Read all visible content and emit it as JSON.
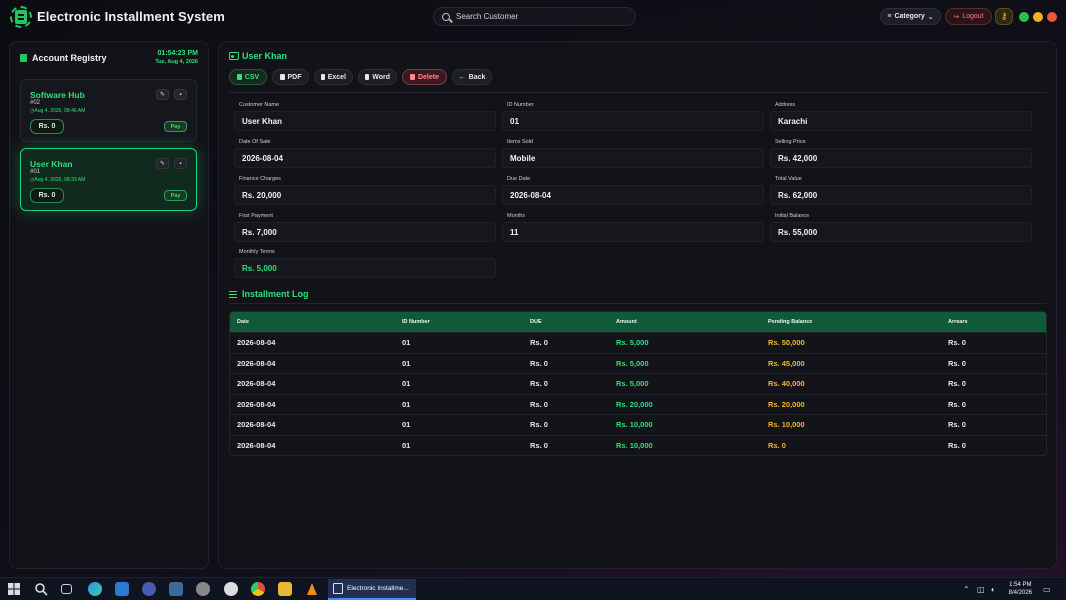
{
  "header": {
    "app_title": "Electronic Installment System",
    "search_placeholder": "Search Customer",
    "category_label": "Category",
    "logout_label": "Logout"
  },
  "registry": {
    "title": "Account Registry",
    "time": "01:54:23 PM",
    "date": "Tue, Aug 4, 2026",
    "accounts": [
      {
        "name": "Software Hub",
        "id": "#02",
        "timestamp": "Aug 4, 2026, 08:46 AM",
        "balance": "Rs. 0",
        "pay_label": "Pay",
        "selected": false
      },
      {
        "name": "User Khan",
        "id": "#01",
        "timestamp": "Aug 4, 2026, 08:33 AM",
        "balance": "Rs. 0",
        "pay_label": "Pay",
        "selected": true
      }
    ]
  },
  "customer": {
    "title": "User Khan",
    "toolbar": {
      "csv": "CSV",
      "pdf": "PDF",
      "excel": "Excel",
      "word": "Word",
      "delete": "Delete",
      "back": "Back"
    },
    "fields": {
      "customer_name": {
        "label": "Customer Name",
        "value": "User Khan"
      },
      "id_number": {
        "label": "ID Number",
        "value": "01"
      },
      "address": {
        "label": "Address",
        "value": "Karachi"
      },
      "date_of_sale": {
        "label": "Date Of Sale",
        "value": "2026-08-04"
      },
      "items_sold": {
        "label": "Items Sold",
        "value": "Mobile"
      },
      "selling_price": {
        "label": "Selling Price",
        "value": "Rs. 42,000"
      },
      "finance_charges": {
        "label": "Finance Charges",
        "value": "Rs. 20,000"
      },
      "due_date": {
        "label": "Due Date",
        "value": "2026-08-04"
      },
      "total_value": {
        "label": "Total Value",
        "value": "Rs. 62,000"
      },
      "first_payment": {
        "label": "First Payment",
        "value": "Rs. 7,000"
      },
      "months": {
        "label": "Months",
        "value": "11"
      },
      "initial_balance": {
        "label": "Initial Balance",
        "value": "Rs. 55,000"
      },
      "monthly_terms": {
        "label": "Monthly Terms",
        "value": "Rs. 5,000"
      }
    }
  },
  "log": {
    "title": "Installment Log",
    "columns": [
      "Date",
      "ID Number",
      "DUE",
      "Amount",
      "Pending Balance",
      "Arrears"
    ],
    "rows": [
      [
        "2026-08-04",
        "01",
        "Rs. 0",
        "Rs. 5,000",
        "Rs. 50,000",
        "Rs. 0"
      ],
      [
        "2026-08-04",
        "01",
        "Rs. 0",
        "Rs. 5,000",
        "Rs. 45,000",
        "Rs. 0"
      ],
      [
        "2026-08-04",
        "01",
        "Rs. 0",
        "Rs. 5,000",
        "Rs. 40,000",
        "Rs. 0"
      ],
      [
        "2026-08-04",
        "01",
        "Rs. 0",
        "Rs. 20,000",
        "Rs. 20,000",
        "Rs. 0"
      ],
      [
        "2026-08-04",
        "01",
        "Rs. 0",
        "Rs. 10,000",
        "Rs. 10,000",
        "Rs. 0"
      ],
      [
        "2026-08-04",
        "01",
        "Rs. 0",
        "Rs. 10,000",
        "Rs. 0",
        "Rs. 0"
      ]
    ]
  },
  "taskbar": {
    "active_app_label": "Electronic Installme...",
    "clock_time": "1:54 PM",
    "clock_date": "8/4/2026"
  },
  "colors": {
    "accent": "#2ee07a",
    "pending": "#f5b52e",
    "table_header": "#0e5a3a",
    "danger": "#ff7a7a"
  }
}
